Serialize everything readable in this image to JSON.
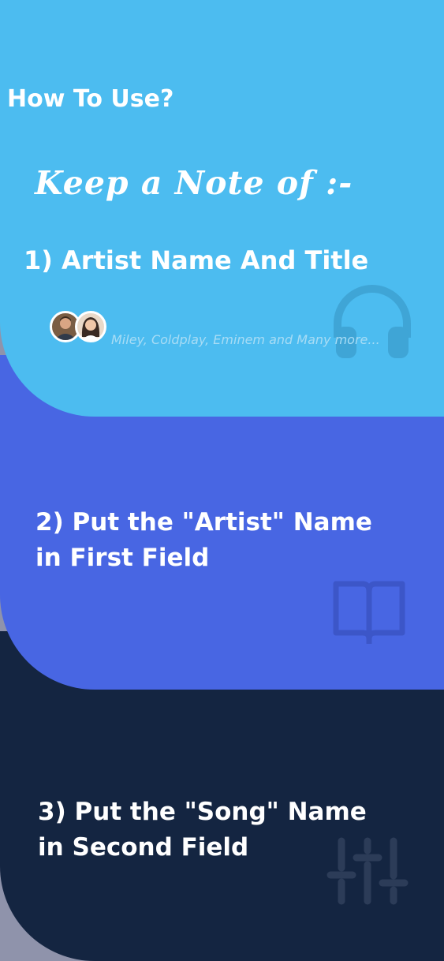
{
  "page": {
    "title": "How To Use?",
    "subtitle": "Keep a Note of :-"
  },
  "steps": [
    {
      "text": "1) Artist Name And Title"
    },
    {
      "line1": "2)  Put the \"Artist\" Name",
      "line2": "in First Field"
    },
    {
      "line1": "3)  Put the \"Song\" Name",
      "line2": "in Second  Field"
    }
  ],
  "artists_caption": "Miley, Coldplay, Eminem and Many more...",
  "icons": [
    "headphones-icon",
    "book-icon",
    "sliders-icon"
  ],
  "colors": {
    "section1": "#4cbcf0",
    "section2": "#4866e3",
    "section3": "#142541",
    "text": "#ffffff"
  }
}
